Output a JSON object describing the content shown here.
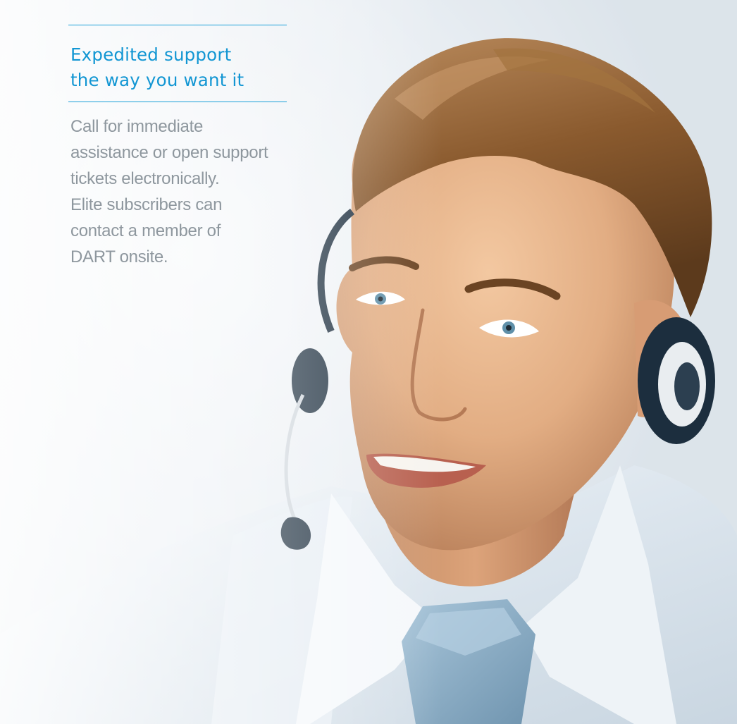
{
  "headline": {
    "line1": "Expedited support",
    "line2": "the way you want it"
  },
  "body": {
    "line1": "Call for immediate",
    "line2": "assistance or open support",
    "line3": "tickets electronically.",
    "line4": "Elite subscribers can",
    "line5": "contact a member of",
    "line6": "DART onsite."
  },
  "colors": {
    "accent": "#1296d3",
    "body_text": "#8e979e",
    "shirt": "#e8eef4",
    "tie": "#8fb3cc",
    "hair": "#8a5a2e",
    "skin": "#e2ad83",
    "headset": "#1c2e3e"
  }
}
